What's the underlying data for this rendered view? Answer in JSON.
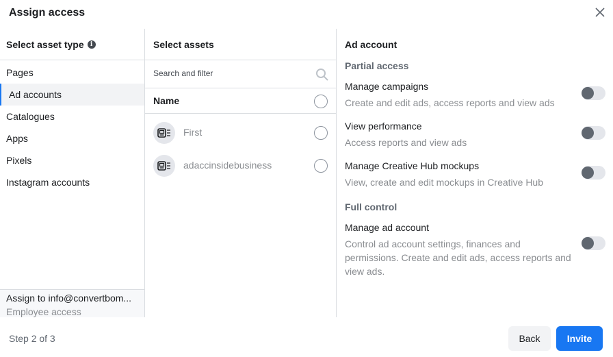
{
  "dialog": {
    "title": "Assign access",
    "close_icon": "close-x-icon"
  },
  "asset_types": {
    "heading": "Select asset type",
    "info_icon": "i",
    "items": [
      {
        "label": "Pages",
        "selected": false
      },
      {
        "label": "Ad accounts",
        "selected": true
      },
      {
        "label": "Catalogues",
        "selected": false
      },
      {
        "label": "Apps",
        "selected": false
      },
      {
        "label": "Pixels",
        "selected": false
      },
      {
        "label": "Instagram accounts",
        "selected": false
      }
    ],
    "assign_to": "Assign to info@convertbom...",
    "access_type": "Employee access"
  },
  "assets": {
    "heading": "Select assets",
    "search_placeholder": "Search and filter",
    "search_value": "",
    "name_header": "Name",
    "items": [
      {
        "name": "First",
        "icon": "ad-account-icon",
        "checked": false
      },
      {
        "name": "adaccinsidebusiness",
        "icon": "ad-account-icon",
        "checked": false
      }
    ]
  },
  "permissions": {
    "heading": "Ad account",
    "groups": [
      {
        "label": "Partial access",
        "items": [
          {
            "title": "Manage campaigns",
            "description": "Create and edit ads, access reports and view ads",
            "enabled": false
          },
          {
            "title": "View performance",
            "description": "Access reports and view ads",
            "enabled": false
          },
          {
            "title": "Manage Creative Hub mockups",
            "description": "View, create and edit mockups in Creative Hub",
            "enabled": false
          }
        ]
      },
      {
        "label": "Full control",
        "items": [
          {
            "title": "Manage ad account",
            "description": "Control ad account settings, finances and permissions. Create and edit ads, access reports and view ads.",
            "enabled": false
          }
        ]
      }
    ]
  },
  "footer": {
    "step": "Step 2 of 3",
    "back_label": "Back",
    "invite_label": "Invite",
    "accent_color": "#1877f2"
  }
}
